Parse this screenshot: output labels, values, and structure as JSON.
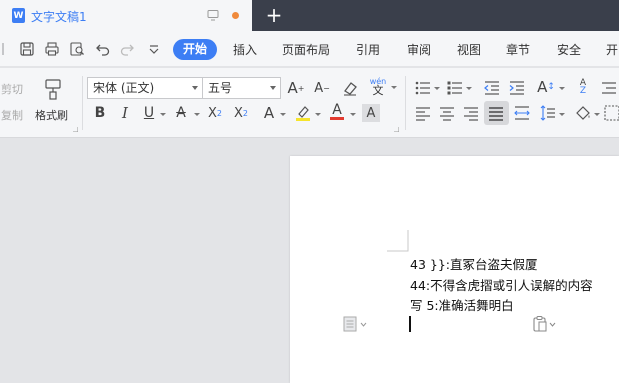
{
  "tab": {
    "title": "文字文稿1",
    "app_icon_letter": "W",
    "add_symbol": "+"
  },
  "menu": {
    "start": "开始",
    "items": [
      "插入",
      "页面布局",
      "引用",
      "审阅",
      "视图",
      "章节",
      "安全",
      "开"
    ]
  },
  "ribbon": {
    "cut": "剪切",
    "copy": "复制",
    "format_painter": "格式刷",
    "font_name": "宋体 (正文)",
    "font_size": "五号",
    "pinyin_label": "wén"
  },
  "document": {
    "lines": [
      "43 }}:直冢台盗夫假厦",
      "44:不得含虎摺或引人误解的内容",
      "写 5:准确活舞明白"
    ]
  },
  "colors": {
    "accent": "#3d7ef4",
    "dark_tab": "#3a3f4b",
    "dot": "#f08a3c",
    "highlight_yellow": "#f6e42b",
    "font_color_red": "#e33b30",
    "font_color_blue": "#1d3fd1"
  },
  "icons": {
    "quick_access": [
      "save-icon",
      "print-icon",
      "print-preview-icon",
      "undo-icon",
      "redo-icon",
      "more-icon"
    ],
    "font": [
      "bold-icon",
      "italic-icon",
      "underline-icon",
      "strikethrough-icon",
      "superscript-icon",
      "subscript-icon",
      "text-effect-icon",
      "highlight-icon",
      "font-color-icon",
      "char-shading-icon"
    ],
    "paragraph": [
      "bullet-list-icon",
      "numbered-list-icon",
      "decrease-indent-icon",
      "increase-indent-icon",
      "text-direction-icon",
      "sort-icon",
      "align-left-icon",
      "align-center-icon",
      "align-right-icon",
      "justify-icon",
      "distribute-icon",
      "line-spacing-icon",
      "shading-icon",
      "borders-icon"
    ]
  }
}
